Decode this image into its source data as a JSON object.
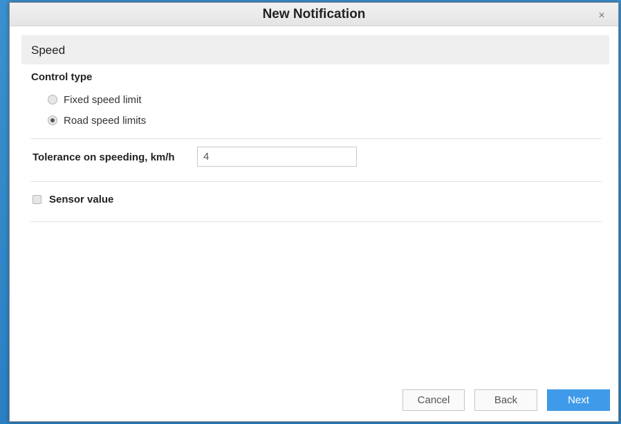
{
  "dialog": {
    "title": "New Notification",
    "close_icon": "close-icon",
    "close_glyph": "×"
  },
  "section": {
    "title": "Speed"
  },
  "control_type": {
    "label": "Control type",
    "options": [
      {
        "label": "Fixed speed limit",
        "checked": false
      },
      {
        "label": "Road speed limits",
        "checked": true
      }
    ]
  },
  "tolerance": {
    "label": "Tolerance on speeding, km/h",
    "value": "4"
  },
  "sensor": {
    "label": "Sensor value",
    "checked": false
  },
  "footer": {
    "cancel_label": "Cancel",
    "back_label": "Back",
    "next_label": "Next"
  },
  "colors": {
    "backdrop": "#2f87c9",
    "primary_button": "#3f9bea"
  }
}
